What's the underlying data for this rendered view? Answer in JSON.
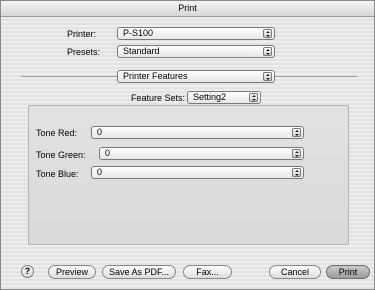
{
  "window": {
    "title": "Print"
  },
  "printer": {
    "label": "Printer:",
    "value": "P-S100"
  },
  "presets": {
    "label": "Presets:",
    "value": "Standard"
  },
  "section": {
    "value": "Printer Features"
  },
  "feature_sets": {
    "label": "Feature Sets:",
    "value": "Setting2"
  },
  "tones": [
    {
      "label": "Tone Red:",
      "value": "0"
    },
    {
      "label": "Tone Green:",
      "value": "0"
    },
    {
      "label": "Tone Blue:",
      "value": "0"
    }
  ],
  "buttons": {
    "help": "?",
    "preview": "Preview",
    "save_pdf": "Save As PDF...",
    "fax": "Fax...",
    "cancel": "Cancel",
    "print": "Print"
  }
}
